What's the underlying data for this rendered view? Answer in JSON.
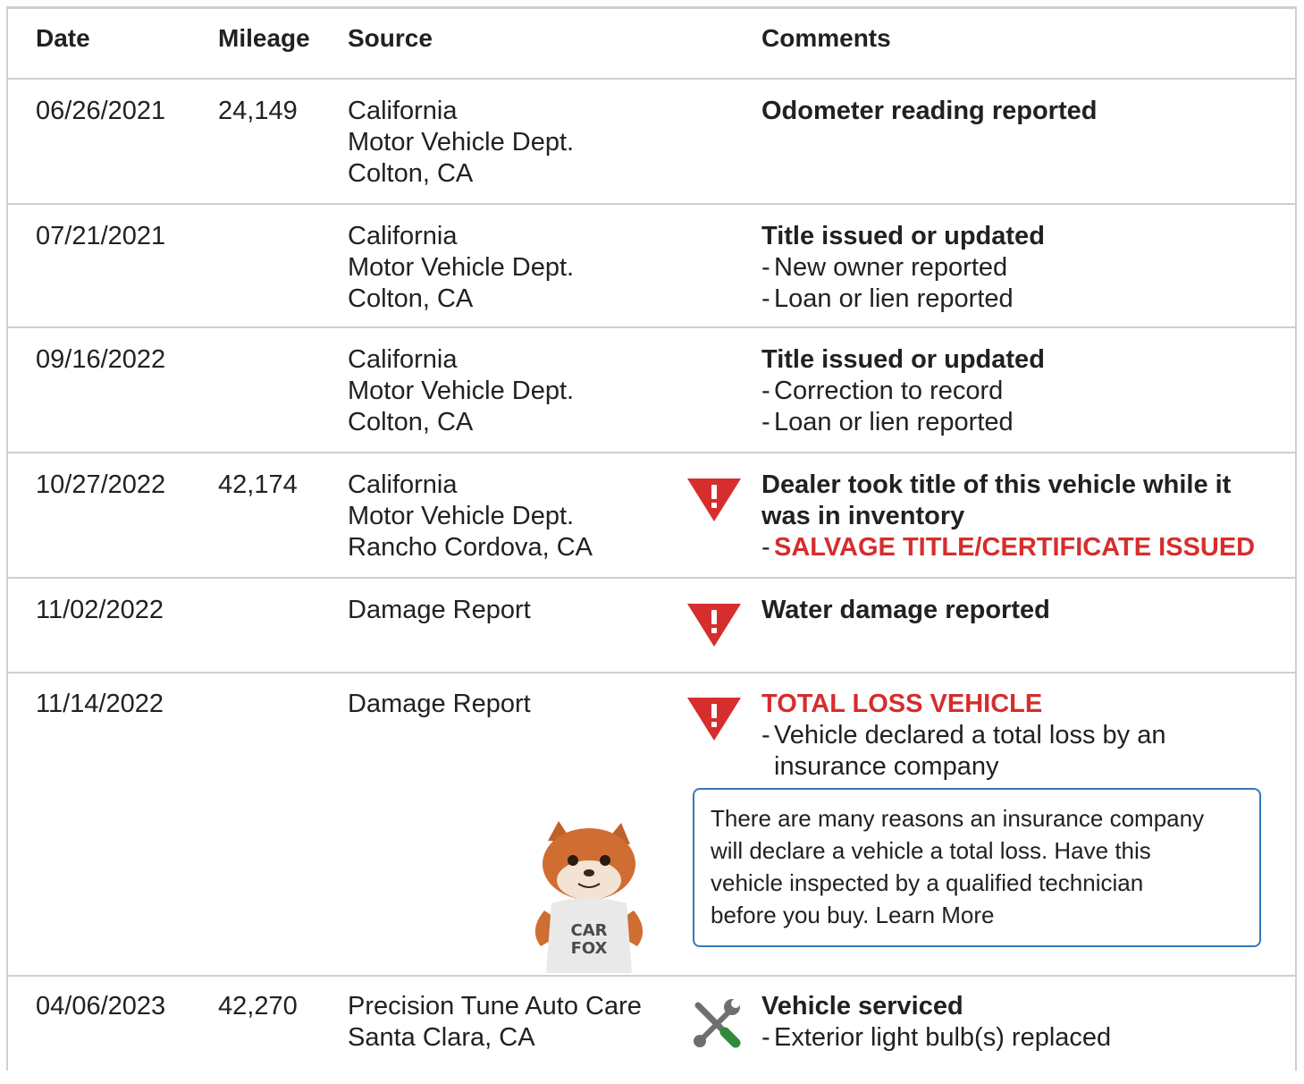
{
  "headers": {
    "date": "Date",
    "mileage": "Mileage",
    "source": "Source",
    "comments": "Comments"
  },
  "rows": [
    {
      "date": "06/26/2021",
      "mileage": "24,149",
      "source": [
        "California",
        "Motor Vehicle Dept.",
        "Colton, CA"
      ],
      "icon": "",
      "comment_title": "Odometer reading reported",
      "details": []
    },
    {
      "date": "07/21/2021",
      "mileage": "",
      "source": [
        "California",
        "Motor Vehicle Dept.",
        "Colton, CA"
      ],
      "icon": "",
      "comment_title": "Title issued or updated",
      "details": [
        "New owner reported",
        "Loan or lien reported"
      ]
    },
    {
      "date": "09/16/2022",
      "mileage": "",
      "source": [
        "California",
        "Motor Vehicle Dept.",
        "Colton, CA"
      ],
      "icon": "",
      "comment_title": "Title issued or updated",
      "details": [
        "Correction to record",
        "Loan or lien reported"
      ]
    },
    {
      "date": "10/27/2022",
      "mileage": "42,174",
      "source": [
        "California",
        "Motor Vehicle Dept.",
        "Rancho Cordova, CA"
      ],
      "icon": "alert-triangle-icon",
      "comment_title": "Dealer took title of this vehicle while it was in inventory",
      "details": [
        "SALVAGE TITLE/CERTIFICATE ISSUED"
      ]
    },
    {
      "date": "11/02/2022",
      "mileage": "",
      "source": [
        "Damage Report"
      ],
      "icon": "alert-triangle-icon",
      "comment_title": "Water damage reported",
      "details": []
    },
    {
      "date": "11/14/2022",
      "mileage": "",
      "source": [
        "Damage Report"
      ],
      "icon": "alert-triangle-icon",
      "comment_title": "TOTAL LOSS VEHICLE",
      "details": [
        "Vehicle declared a total loss by an insurance company"
      ]
    },
    {
      "date": "04/06/2023",
      "mileage": "42,270",
      "source": [
        "Precision Tune Auto Care",
        "Santa Clara, CA"
      ],
      "icon": "wrench-screwdriver-icon",
      "comment_title": "Vehicle serviced",
      "details": [
        "Exterior light bulb(s) replaced"
      ]
    }
  ],
  "callout": {
    "lines": [
      "There are many reasons an insurance company",
      "will declare a vehicle a total loss. Have this",
      "vehicle inspected by a qualified technician",
      "before you buy."
    ],
    "link": "Learn More"
  },
  "mascot": {
    "shirt_line1": "CAR",
    "shirt_line2": "FOX"
  },
  "colors": {
    "alert": "#d62d2d",
    "callout_border": "#3777bc",
    "divider": "#cfcfcf"
  }
}
